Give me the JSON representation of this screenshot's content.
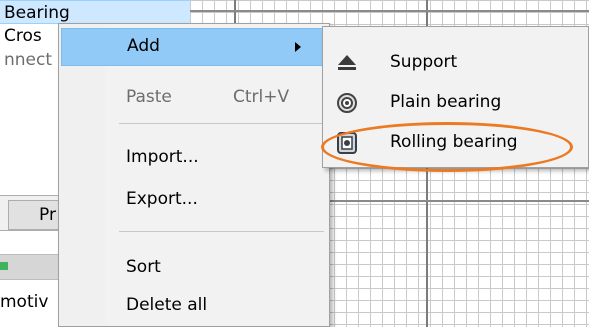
{
  "background_list": {
    "rows": [
      {
        "text": "Bearing"
      },
      {
        "text": "Cros"
      },
      {
        "text": "nnect"
      }
    ],
    "tab_label": "Pr",
    "bottom_text": "motiv"
  },
  "context_menu": {
    "items": [
      {
        "label": "Add",
        "shortcut": "",
        "has_submenu": true,
        "state": "highlighted"
      },
      {
        "label": "Paste",
        "shortcut": "Ctrl+V",
        "has_submenu": false,
        "state": "disabled"
      },
      {
        "label": "Import...",
        "shortcut": "",
        "has_submenu": false,
        "state": "normal"
      },
      {
        "label": "Export...",
        "shortcut": "",
        "has_submenu": false,
        "state": "normal"
      },
      {
        "label": "Sort",
        "shortcut": "",
        "has_submenu": false,
        "state": "normal"
      },
      {
        "label": "Delete all",
        "shortcut": "",
        "has_submenu": false,
        "state": "normal"
      }
    ]
  },
  "submenu_add": {
    "items": [
      {
        "label": "Support",
        "icon": "eject-icon"
      },
      {
        "label": "Plain bearing",
        "icon": "plain-bearing-icon"
      },
      {
        "label": "Rolling bearing",
        "icon": "rolling-bearing-icon",
        "annotated": true
      }
    ]
  },
  "colors": {
    "menu_highlight": "#91c9f7",
    "annotation_outline": "#ec7a22",
    "grid_line": "#c9c9c9",
    "selected_row": "#cde8ff"
  }
}
